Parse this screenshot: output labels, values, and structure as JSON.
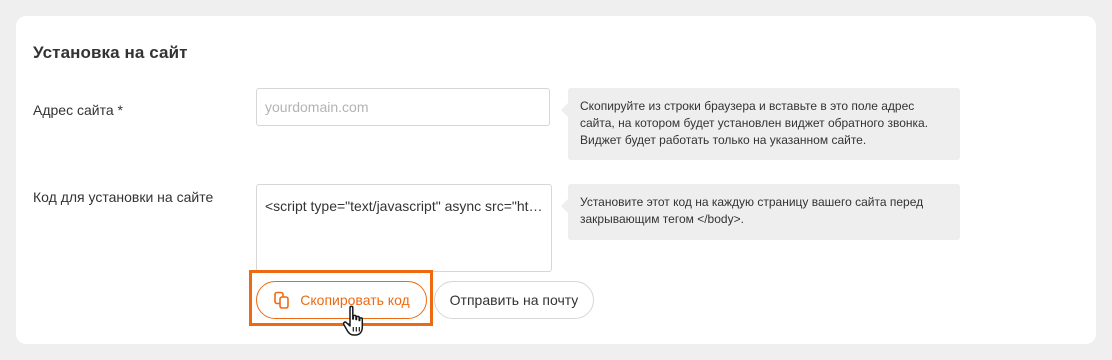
{
  "section": {
    "title": "Установка на сайт"
  },
  "site_address": {
    "label": "Адрес сайта *",
    "value": "",
    "placeholder": "yourdomain.com",
    "hint": "Скопируйте из строки браузера и вставьте в это поле адрес сайта, на котором будет установлен виджет обратного звонка. Виджет будет работать только на указанном сайте."
  },
  "install_code": {
    "label": "Код для установки на сайте",
    "code": "<script type=\"text/javascript\" async src=\"htt...",
    "hint": "Установите этот код на каждую страницу вашего сайта перед закрывающим тегом </body>."
  },
  "actions": {
    "copy_label": "Скопировать код",
    "copy_icon": "copy-icon",
    "send_label": "Отправить на почту"
  },
  "colors": {
    "accent": "#ee6a12",
    "hint_background": "#eeeeee",
    "page_background": "#efefef"
  },
  "pointer": "hand-cursor-icon"
}
